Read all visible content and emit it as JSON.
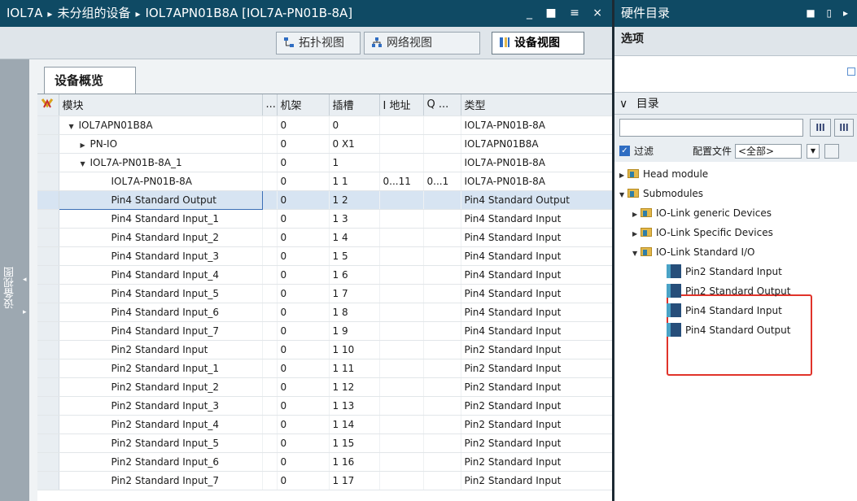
{
  "left_window": {
    "breadcrumb": [
      "IOL7A",
      "未分组的设备",
      "IOL7APN01B8A [IOL7A-PN01B-8A]"
    ],
    "breadcrumb_sep": "▸",
    "window_controls": "_ ■ ≡ ×"
  },
  "view_tabs": [
    {
      "label": "拓扑视图"
    },
    {
      "label": "网络视图"
    },
    {
      "label": "设备视图"
    }
  ],
  "side_strip_label": "设备视图",
  "overview_tab": "设备概览",
  "table": {
    "headers": [
      "",
      "模块",
      "...",
      "机架",
      "插槽",
      "I 地址",
      "Q ...",
      "类型"
    ],
    "rows": [
      {
        "module": "IOL7APN01B8A",
        "rack": "0",
        "slot": "0",
        "i": "",
        "q": "",
        "type": "IOL7A-PN01B-8A",
        "tri": "▼"
      },
      {
        "module": "PN-IO",
        "rack": "0",
        "slot": "0 X1",
        "i": "",
        "q": "",
        "type": "IOL7APN01B8A",
        "tri": "▶"
      },
      {
        "module": "IOL7A-PN01B-8A_1",
        "rack": "0",
        "slot": "1",
        "i": "",
        "q": "",
        "type": "IOL7A-PN01B-8A",
        "tri": "▼"
      },
      {
        "module": "IOL7A-PN01B-8A",
        "rack": "0",
        "slot": "1 1",
        "i": "0...11",
        "q": "0...1",
        "type": "IOL7A-PN01B-8A",
        "tri": ""
      },
      {
        "module": "Pin4 Standard Output",
        "rack": "0",
        "slot": "1 2",
        "i": "",
        "q": "",
        "type": "Pin4 Standard Output",
        "tri": ""
      },
      {
        "module": "Pin4 Standard Input_1",
        "rack": "0",
        "slot": "1 3",
        "i": "",
        "q": "",
        "type": "Pin4 Standard Input",
        "tri": ""
      },
      {
        "module": "Pin4 Standard Input_2",
        "rack": "0",
        "slot": "1 4",
        "i": "",
        "q": "",
        "type": "Pin4 Standard Input",
        "tri": ""
      },
      {
        "module": "Pin4 Standard Input_3",
        "rack": "0",
        "slot": "1 5",
        "i": "",
        "q": "",
        "type": "Pin4 Standard Input",
        "tri": ""
      },
      {
        "module": "Pin4 Standard Input_4",
        "rack": "0",
        "slot": "1 6",
        "i": "",
        "q": "",
        "type": "Pin4 Standard Input",
        "tri": ""
      },
      {
        "module": "Pin4 Standard Input_5",
        "rack": "0",
        "slot": "1 7",
        "i": "",
        "q": "",
        "type": "Pin4 Standard Input",
        "tri": ""
      },
      {
        "module": "Pin4 Standard Input_6",
        "rack": "0",
        "slot": "1 8",
        "i": "",
        "q": "",
        "type": "Pin4 Standard Input",
        "tri": ""
      },
      {
        "module": "Pin4 Standard Input_7",
        "rack": "0",
        "slot": "1 9",
        "i": "",
        "q": "",
        "type": "Pin4 Standard Input",
        "tri": ""
      },
      {
        "module": "Pin2 Standard Input",
        "rack": "0",
        "slot": "1 10",
        "i": "",
        "q": "",
        "type": "Pin2 Standard Input",
        "tri": ""
      },
      {
        "module": "Pin2 Standard Input_1",
        "rack": "0",
        "slot": "1 11",
        "i": "",
        "q": "",
        "type": "Pin2 Standard Input",
        "tri": ""
      },
      {
        "module": "Pin2 Standard Input_2",
        "rack": "0",
        "slot": "1 12",
        "i": "",
        "q": "",
        "type": "Pin2 Standard Input",
        "tri": ""
      },
      {
        "module": "Pin2 Standard Input_3",
        "rack": "0",
        "slot": "1 13",
        "i": "",
        "q": "",
        "type": "Pin2 Standard Input",
        "tri": ""
      },
      {
        "module": "Pin2 Standard Input_4",
        "rack": "0",
        "slot": "1 14",
        "i": "",
        "q": "",
        "type": "Pin2 Standard Input",
        "tri": ""
      },
      {
        "module": "Pin2 Standard Input_5",
        "rack": "0",
        "slot": "1 15",
        "i": "",
        "q": "",
        "type": "Pin2 Standard Input",
        "tri": ""
      },
      {
        "module": "Pin2 Standard Input_6",
        "rack": "0",
        "slot": "1 16",
        "i": "",
        "q": "",
        "type": "Pin2 Standard Input",
        "tri": ""
      },
      {
        "module": "Pin2 Standard Input_7",
        "rack": "0",
        "slot": "1 17",
        "i": "",
        "q": "",
        "type": "Pin2 Standard Input",
        "tri": ""
      }
    ],
    "selected_row": 4
  },
  "right_panel": {
    "title": "硬件目录",
    "options_label": "选项",
    "catalog_label": "目录",
    "catalog_toggle": "∨",
    "search_value": "",
    "search_btn1": "ǀǀǀ",
    "search_btn2": "ǀǀǀ",
    "filter_checked": "✓",
    "filter_label": "过滤",
    "profile_label": "配置文件",
    "profile_value": "<全部>",
    "profile_dropdown": "▼",
    "tree": [
      {
        "label": "Head module",
        "type": "folder",
        "indent": 0,
        "tri": "▶"
      },
      {
        "label": "Submodules",
        "type": "folder",
        "indent": 0,
        "tri": "▼"
      },
      {
        "label": "IO-Link generic Devices",
        "type": "folder",
        "indent": 1,
        "tri": "▶"
      },
      {
        "label": "IO-Link Specific Devices",
        "type": "folder",
        "indent": 1,
        "tri": "▶"
      },
      {
        "label": "IO-Link Standard I/O",
        "type": "folder",
        "indent": 1,
        "tri": "▼"
      },
      {
        "label": "Pin2 Standard Input",
        "type": "module",
        "indent": 2,
        "tri": ""
      },
      {
        "label": "Pin2 Standard Output",
        "type": "module",
        "indent": 2,
        "tri": ""
      },
      {
        "label": "Pin4 Standard Input",
        "type": "module",
        "indent": 2,
        "tri": ""
      },
      {
        "label": "Pin4 Standard Output",
        "type": "module",
        "indent": 2,
        "tri": ""
      }
    ],
    "highlight_color": "#e0332a"
  },
  "colors": {
    "title_bar": "#0f4a64",
    "selection": "#d7e4f2"
  }
}
